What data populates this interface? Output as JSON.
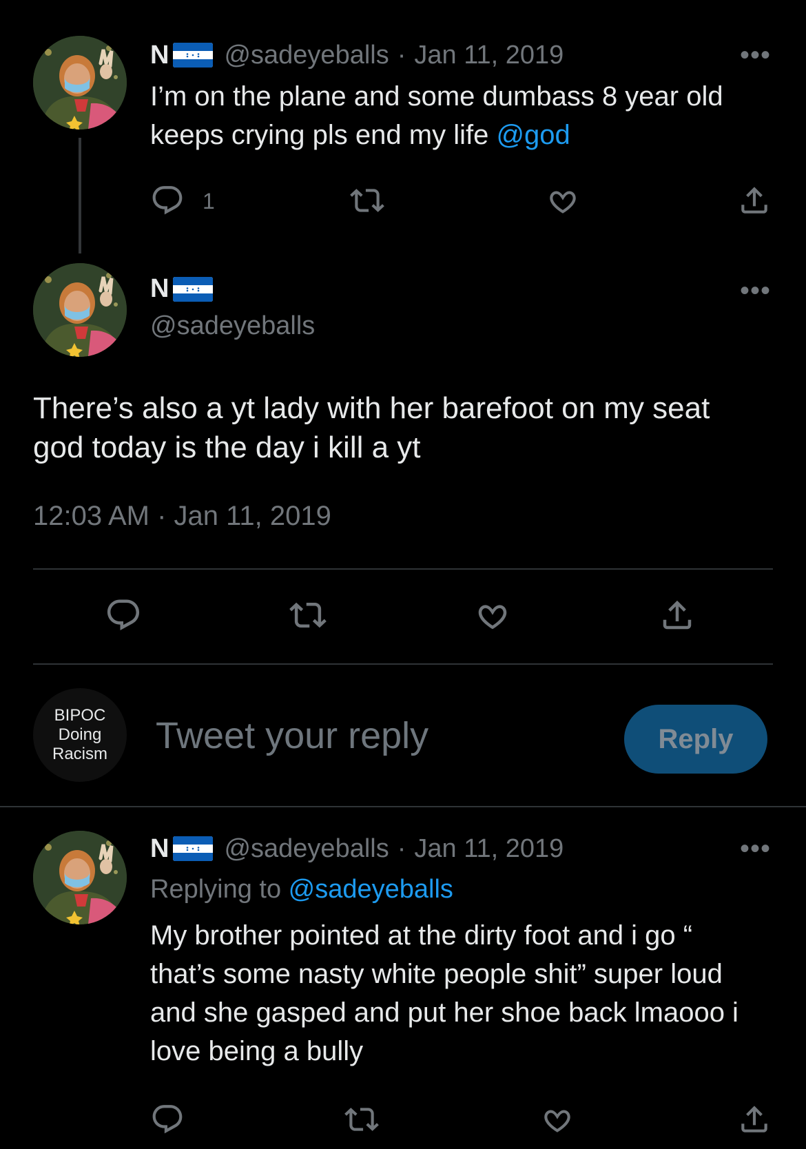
{
  "tweets": [
    {
      "name": "N",
      "handle": "@sadeyeballs",
      "sep": "·",
      "date": "Jan 11, 2019",
      "text_before": "I’m on the plane and some dumbass 8 year old keeps crying pls end my life ",
      "mention": "@god",
      "reply_count": "1",
      "more": "•••"
    },
    {
      "name": "N",
      "handle": "@sadeyeballs",
      "text": "There’s also a yt lady with her barefoot on my seat god today is the day i kill a yt",
      "timestamp": "12:03 AM · Jan 11, 2019",
      "more": "•••"
    },
    {
      "name": "N",
      "handle": "@sadeyeballs",
      "sep": "·",
      "date": "Jan 11, 2019",
      "replying_prefix": "Replying to ",
      "replying_handle": "@sadeyeballs",
      "text": "My brother pointed at the dirty foot and i go “ that’s some nasty white people shit” super loud and she gasped and put her shoe back lmaooo i love being a bully",
      "more": "•••"
    }
  ],
  "composer": {
    "avatar_text": [
      "BIPOC",
      "Doing",
      "Racism"
    ],
    "placeholder": "Tweet your reply",
    "reply_button": "Reply"
  },
  "icons": {
    "reply": "reply-icon",
    "retweet": "retweet-icon",
    "like": "heart-icon",
    "share": "share-icon",
    "more": "more-icon"
  },
  "colors": {
    "background": "#000000",
    "text": "#e7e9ea",
    "muted": "#71767b",
    "link": "#1d9bf0",
    "reply_button": "#0f4e78",
    "divider": "#2f3336"
  }
}
